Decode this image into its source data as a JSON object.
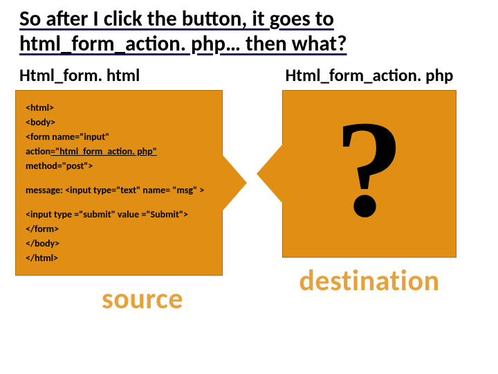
{
  "title": "So after I click the button, it goes to html_form_action. php… then what?",
  "left": {
    "heading": "Html_form. html",
    "code_line1": "<html>",
    "code_line2": "<body>",
    "code_line3a": "<form name=\"input\" action",
    "code_line3b": "=\"html_form_action. php\"",
    "code_line3c": " method=\"post\">",
    "code_line4": "message: <input type=\"text\" name= \"msg\" >",
    "code_line5": "<input type =\"submit\" value =\"Submit\">",
    "code_line6": "</form>",
    "code_line7": "</body>",
    "code_line8": "</html>",
    "label": "source"
  },
  "right": {
    "heading": "Html_form_action. php",
    "question": "?",
    "label": "destination"
  }
}
